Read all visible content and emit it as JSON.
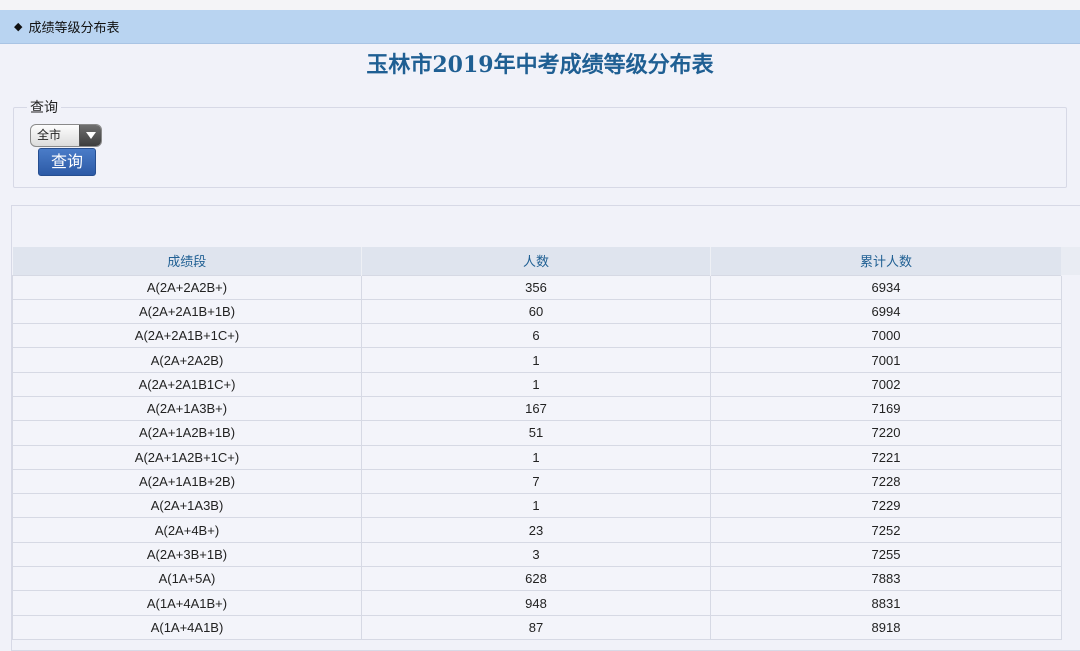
{
  "header": {
    "marker": "◆",
    "title": "成绩等级分布表"
  },
  "page_title": "玉林市2019年中考成绩等级分布表",
  "query": {
    "legend": "查询",
    "select_value": "全市",
    "button_label": "查询"
  },
  "table": {
    "columns": [
      "成绩段",
      "人数",
      "累计人数"
    ],
    "rows": [
      [
        "A(2A+2A2B+)",
        "356",
        "6934"
      ],
      [
        "A(2A+2A1B+1B)",
        "60",
        "6994"
      ],
      [
        "A(2A+2A1B+1C+)",
        "6",
        "7000"
      ],
      [
        "A(2A+2A2B)",
        "1",
        "7001"
      ],
      [
        "A(2A+2A1B1C+)",
        "1",
        "7002"
      ],
      [
        "A(2A+1A3B+)",
        "167",
        "7169"
      ],
      [
        "A(2A+1A2B+1B)",
        "51",
        "7220"
      ],
      [
        "A(2A+1A2B+1C+)",
        "1",
        "7221"
      ],
      [
        "A(2A+1A1B+2B)",
        "7",
        "7228"
      ],
      [
        "A(2A+1A3B)",
        "1",
        "7229"
      ],
      [
        "A(2A+4B+)",
        "23",
        "7252"
      ],
      [
        "A(2A+3B+1B)",
        "3",
        "7255"
      ],
      [
        "A(1A+5A)",
        "628",
        "7883"
      ],
      [
        "A(1A+4A1B+)",
        "948",
        "8831"
      ],
      [
        "A(1A+4A1B)",
        "87",
        "8918"
      ]
    ]
  }
}
